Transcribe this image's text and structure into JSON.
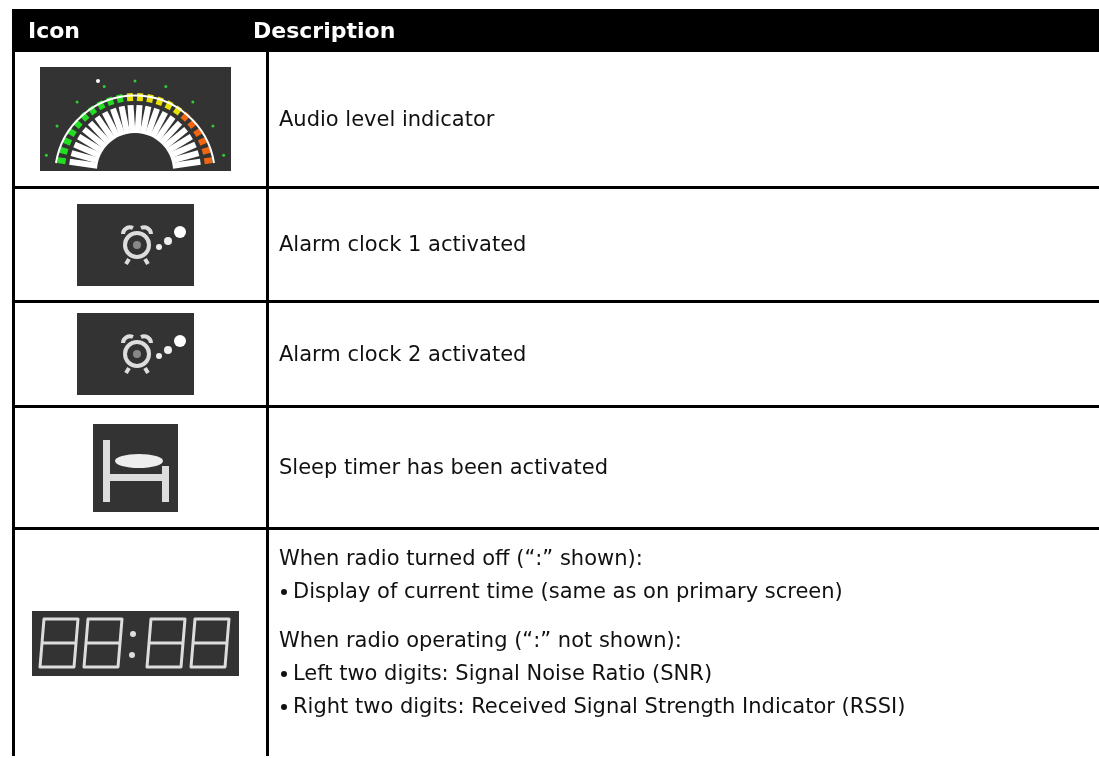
{
  "table": {
    "columns": [
      "Icon",
      "Description"
    ],
    "rows": [
      {
        "kind": "level-meter",
        "blocks": [
          {
            "heading": "Audio level indicator"
          }
        ]
      },
      {
        "kind": "alarm-clock",
        "blocks": [
          {
            "heading": "Alarm clock 1 activated"
          }
        ]
      },
      {
        "kind": "alarm-clock",
        "blocks": [
          {
            "heading": "Alarm clock 2 activated"
          }
        ]
      },
      {
        "kind": "bed",
        "blocks": [
          {
            "heading": "Sleep timer has been activated"
          }
        ]
      },
      {
        "kind": "clock-digits",
        "blocks": [
          {
            "heading": "When radio turned off (“:” shown):",
            "bullets": [
              "Display of current time (same as on primary screen)"
            ]
          },
          {
            "heading": "When radio operating (“:” not shown):",
            "bullets": [
              "Left two digits: Signal Noise Ratio (SNR)",
              "Right two digits: Received Signal Strength Indicator (RSSI)"
            ]
          }
        ]
      }
    ]
  }
}
